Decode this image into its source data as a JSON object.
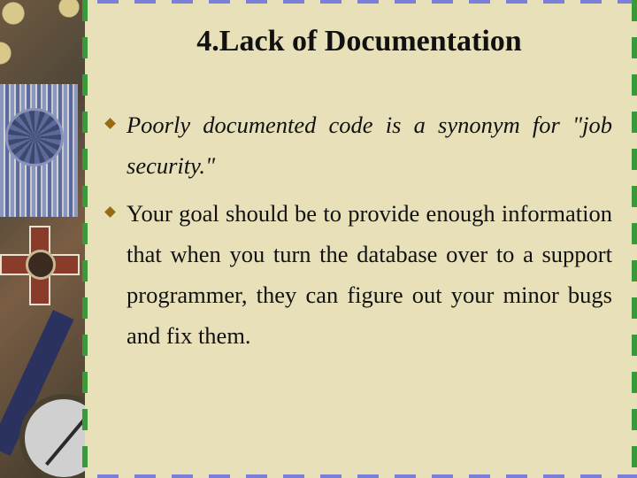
{
  "slide": {
    "title": "4.Lack of Documentation",
    "bullets": [
      {
        "text": "Poorly documented code is a synonym for \"job security.\"",
        "style": "italic",
        "icon": "diamond-bullet-icon"
      },
      {
        "text": "Your goal should be to provide enough information that when you turn the database over to a support programmer, they can figure out your minor bugs and fix them.",
        "style": "normal",
        "icon": "diamond-bullet-icon"
      }
    ]
  },
  "theme": {
    "background": "#e8e0b8",
    "border_top_bottom": "#7a7fd8",
    "border_left_right": "#3a9a3a",
    "bullet_color": "#9a6a10",
    "text_color": "#111111"
  }
}
